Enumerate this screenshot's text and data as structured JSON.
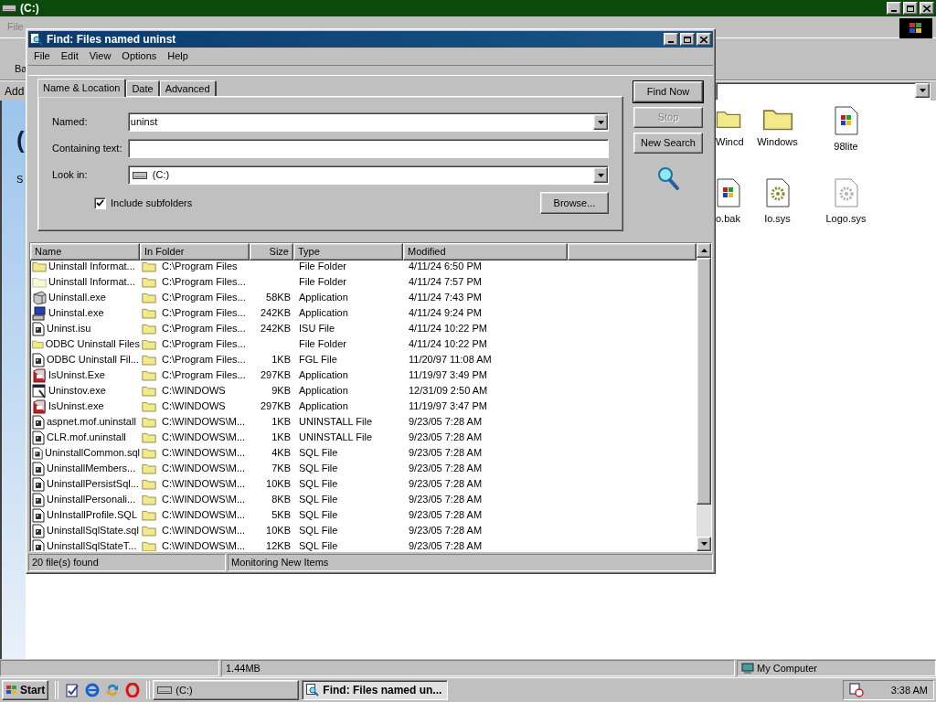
{
  "explorer": {
    "title": "(C:)",
    "menu": [
      "File"
    ],
    "toolbar_label": "Ba",
    "address_label": "Add",
    "web_pane": {
      "heading": "(",
      "text": "S"
    },
    "files": [
      {
        "name": "Wincd",
        "kind": "folder"
      },
      {
        "name": "Windows",
        "kind": "folder"
      },
      {
        "name": "98lite",
        "kind": "windows-doc"
      },
      {
        "name": "o.bak",
        "kind": "windows-doc"
      },
      {
        "name": "Io.sys",
        "kind": "gear-doc"
      },
      {
        "name": "Logo.sys",
        "kind": "gear-doc-light"
      }
    ],
    "status_bar": [
      "1.44MB",
      "My Computer"
    ]
  },
  "find": {
    "title": "Find: Files named uninst",
    "menu": [
      "File",
      "Edit",
      "View",
      "Options",
      "Help"
    ],
    "tabs": [
      {
        "label": "Name & Location",
        "selected": true
      },
      {
        "label": "Date",
        "selected": false
      },
      {
        "label": "Advanced",
        "selected": false
      }
    ],
    "named": {
      "label": "Named:",
      "value": "uninst"
    },
    "containing": {
      "label": "Containing text:"
    },
    "look_in": {
      "label": "Look in:",
      "value": "(C:)"
    },
    "include_subfolders": {
      "label": "Include subfolders",
      "checked": true
    },
    "browse": "Browse...",
    "buttons": [
      {
        "label": "Find Now",
        "default": true,
        "disabled": false
      },
      {
        "label": "Stop",
        "default": false,
        "disabled": true
      },
      {
        "label": "New Search",
        "default": false,
        "disabled": false
      }
    ],
    "columns": [
      "Name",
      "In Folder",
      "Size",
      "Type",
      "Modified"
    ],
    "rows": [
      {
        "kind": "folder",
        "name": "Uninstall Informat...",
        "folder": "C:\\Program Files",
        "size": "",
        "type": "File Folder",
        "modified": "4/11/24 6:50 PM"
      },
      {
        "kind": "folder-hidden",
        "name": "Uninstall Informat...",
        "folder": "C:\\Program Files...",
        "size": "",
        "type": "File Folder",
        "modified": "4/11/24 7:57 PM"
      },
      {
        "kind": "setup",
        "name": "Uninstall.exe",
        "folder": "C:\\Program Files...",
        "size": "58KB",
        "type": "Application",
        "modified": "4/11/24 7:43 PM"
      },
      {
        "kind": "program",
        "name": "Uninstal.exe",
        "folder": "C:\\Program Files...",
        "size": "242KB",
        "type": "Application",
        "modified": "4/11/24 9:24 PM"
      },
      {
        "kind": "document",
        "name": "Uninst.isu",
        "folder": "C:\\Program Files...",
        "size": "242KB",
        "type": "ISU File",
        "modified": "4/11/24 10:22 PM"
      },
      {
        "kind": "folder",
        "name": "ODBC Uninstall Files",
        "folder": "C:\\Program Files...",
        "size": "",
        "type": "File Folder",
        "modified": "4/11/24 10:22 PM"
      },
      {
        "kind": "document",
        "name": "ODBC Uninstall Fil...",
        "folder": "C:\\Program Files...",
        "size": "1KB",
        "type": "FGL File",
        "modified": "11/20/97 11:08 AM"
      },
      {
        "kind": "installer",
        "name": "IsUninst.Exe",
        "folder": "C:\\Program Files...",
        "size": "297KB",
        "type": "Application",
        "modified": "11/19/97 3:49 PM"
      },
      {
        "kind": "window",
        "name": "Uninstov.exe",
        "folder": "C:\\WINDOWS",
        "size": "9KB",
        "type": "Application",
        "modified": "12/31/09 2:50 AM"
      },
      {
        "kind": "installer",
        "name": "IsUninst.exe",
        "folder": "C:\\WINDOWS",
        "size": "297KB",
        "type": "Application",
        "modified": "11/19/97 3:47 PM"
      },
      {
        "kind": "document",
        "name": "aspnet.mof.uninstall",
        "folder": "C:\\WINDOWS\\M...",
        "size": "1KB",
        "type": "UNINSTALL File",
        "modified": "9/23/05 7:28 AM"
      },
      {
        "kind": "document",
        "name": "CLR.mof.uninstall",
        "folder": "C:\\WINDOWS\\M...",
        "size": "1KB",
        "type": "UNINSTALL File",
        "modified": "9/23/05 7:28 AM"
      },
      {
        "kind": "document",
        "name": "UninstallCommon.sql",
        "folder": "C:\\WINDOWS\\M...",
        "size": "4KB",
        "type": "SQL File",
        "modified": "9/23/05 7:28 AM"
      },
      {
        "kind": "document",
        "name": "UninstallMembers...",
        "folder": "C:\\WINDOWS\\M...",
        "size": "7KB",
        "type": "SQL File",
        "modified": "9/23/05 7:28 AM"
      },
      {
        "kind": "document",
        "name": "UninstallPersistSql...",
        "folder": "C:\\WINDOWS\\M...",
        "size": "10KB",
        "type": "SQL File",
        "modified": "9/23/05 7:28 AM"
      },
      {
        "kind": "document",
        "name": "UninstallPersonali...",
        "folder": "C:\\WINDOWS\\M...",
        "size": "8KB",
        "type": "SQL File",
        "modified": "9/23/05 7:28 AM"
      },
      {
        "kind": "document",
        "name": "UnInstallProfile.SQL",
        "folder": "C:\\WINDOWS\\M...",
        "size": "5KB",
        "type": "SQL File",
        "modified": "9/23/05 7:28 AM"
      },
      {
        "kind": "document",
        "name": "UninstallSqlState.sql",
        "folder": "C:\\WINDOWS\\M...",
        "size": "10KB",
        "type": "SQL File",
        "modified": "9/23/05 7:28 AM"
      },
      {
        "kind": "document",
        "name": "UninstallSqlStateT...",
        "folder": "C:\\WINDOWS\\M...",
        "size": "12KB",
        "type": "SQL File",
        "modified": "9/23/05 7:28 AM"
      }
    ],
    "status_bar": [
      "20 file(s) found",
      "Monitoring New Items"
    ]
  },
  "taskbar": {
    "start": "Start",
    "tasks": [
      {
        "label": "(C:)",
        "selected": false,
        "kind": "drive"
      },
      {
        "label": "Find: Files named un...",
        "selected": true,
        "kind": "find"
      }
    ],
    "clock": "3:38 AM"
  }
}
